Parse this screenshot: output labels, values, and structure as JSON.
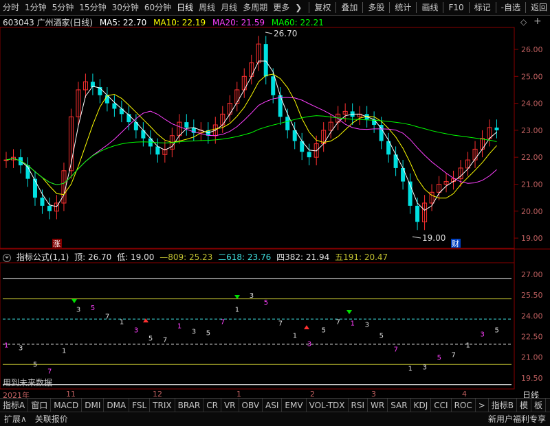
{
  "toolbar": {
    "periods": [
      "分时",
      "1分钟",
      "5分钟",
      "15分钟",
      "30分钟",
      "60分钟",
      "日线",
      "周线",
      "月线",
      "多周期",
      "更多"
    ],
    "active_period": "日线",
    "more_arrow": "❯",
    "right_items": [
      "复权",
      "叠加",
      "多股",
      "统计",
      "画线",
      "F10",
      "标记",
      "-自选",
      "返回"
    ]
  },
  "header": {
    "stock": "603043 广州酒家(日线)",
    "ma5": "MA5: 22.70",
    "ma10": "MA10: 22.19",
    "ma20": "MA20: 21.59",
    "ma60": "MA60: 22.21",
    "diamond": "◇",
    "plus": "+"
  },
  "main_chart": {
    "price_ticks": [
      "26.00",
      "25.00",
      "24.00",
      "23.00",
      "22.00",
      "21.00",
      "20.00",
      "19.00"
    ],
    "high_label": "26.70",
    "low_label": "19.00",
    "zhang_label": "涨",
    "cai_label": "财"
  },
  "indicator": {
    "name": "指标公式(1,1)",
    "ding": "顶: 26.70",
    "di": "低: 19.00",
    "l809": "—809: 25.23",
    "l618": "二618: 23.76",
    "l382": "四382: 21.94",
    "l191": "五191: 20.47",
    "ticks": [
      "27.00",
      "25.50",
      "24.00",
      "22.50",
      "21.00",
      "19.50"
    ],
    "footer_note": "用到未来数据"
  },
  "date_axis": {
    "labels": [
      "2021年",
      "11",
      "12",
      "1",
      "2",
      "3",
      "4"
    ],
    "period_label": "日线"
  },
  "indicator_tabs": [
    "指标A",
    "窗口",
    "MACD",
    "DMI",
    "DMA",
    "FSL",
    "TRIX",
    "BRAR",
    "CR",
    "VR",
    "OBV",
    "ASI",
    "EMV",
    "VOL-TDX",
    "RSI",
    "WR",
    "SAR",
    "KDJ",
    "CCI",
    "ROC",
    ">",
    "指标B",
    "模",
    "板"
  ],
  "statusbar": {
    "expand": "扩展∧",
    "related": "关联报价",
    "right": "新用户福利专享"
  },
  "colors": {
    "up": "#ff3030",
    "down": "#00e0e0",
    "ma5": "#ffffff",
    "ma10": "#ffff00",
    "ma20": "#ff40ff",
    "ma60": "#00ff00"
  }
}
